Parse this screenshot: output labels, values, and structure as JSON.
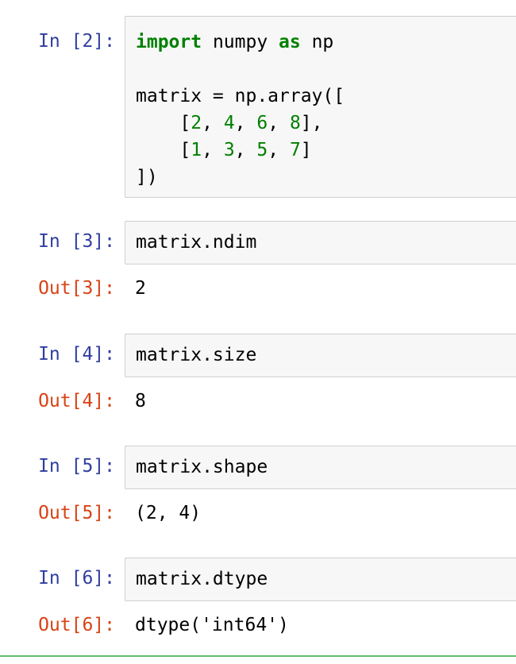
{
  "cells": [
    {
      "in_prompt": "In [2]:",
      "code": {
        "line1_kw1": "import",
        "line1_mid": " numpy ",
        "line1_kw2": "as",
        "line1_end": " np",
        "line3": "matrix = np.array([",
        "row1": {
          "open": "    [",
          "n1": "2",
          "n2": "4",
          "n3": "6",
          "n4": "8",
          "close": "],"
        },
        "row2": {
          "open": "    [",
          "n1": "1",
          "n2": "3",
          "n3": "5",
          "n4": "7",
          "close": "]"
        },
        "line6": "])"
      }
    },
    {
      "in_prompt": "In [3]:",
      "code_text": "matrix.ndim",
      "out_prompt": "Out[3]:",
      "output": "2"
    },
    {
      "in_prompt": "In [4]:",
      "code_text": "matrix.size",
      "out_prompt": "Out[4]:",
      "output": "8"
    },
    {
      "in_prompt": "In [5]:",
      "code_text": "matrix.shape",
      "out_prompt": "Out[5]:",
      "output": "(2, 4)"
    },
    {
      "in_prompt": "In [6]:",
      "code_text": "matrix.dtype",
      "out_prompt": "Out[6]:",
      "output": "dtype('int64')"
    }
  ],
  "colors": {
    "in_prompt": "#303f9f",
    "out_prompt": "#d84315",
    "keyword": "#008000",
    "number": "#008000",
    "cell_bg": "#f7f7f7",
    "cell_border": "#cfcfcf",
    "selected_bar": "#66bb6a"
  }
}
